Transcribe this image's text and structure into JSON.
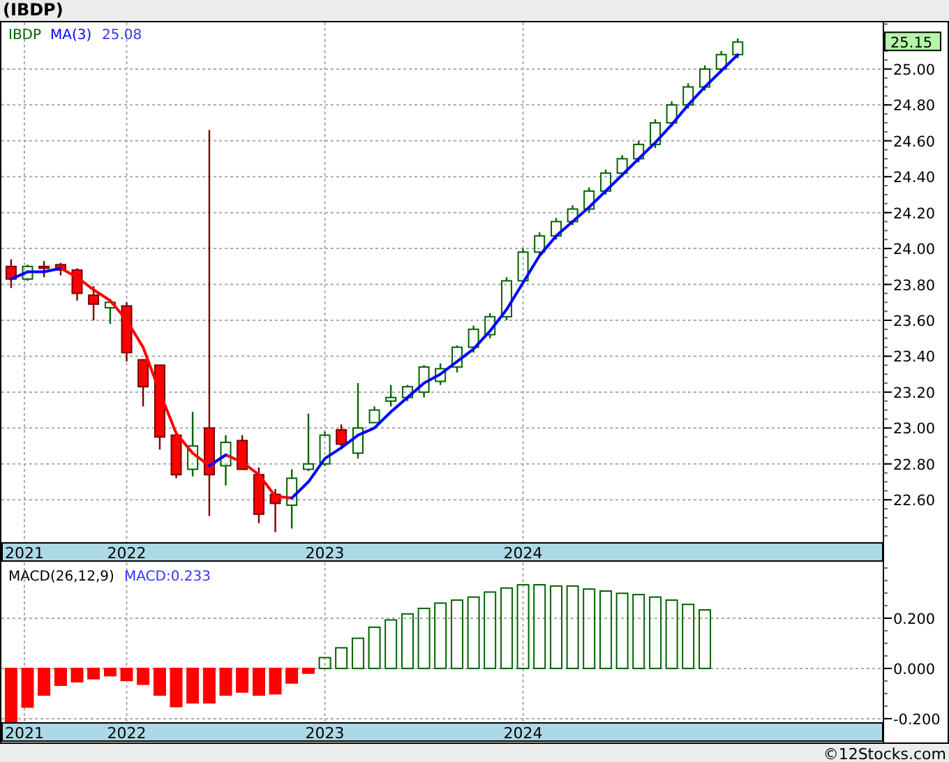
{
  "title": "(IBDP)",
  "price_chart": {
    "legend": {
      "symbol": "IBDP",
      "value": "25.08"
    },
    "last_price": "25.15",
    "chart_data": {
      "type": "candlestick",
      "grid": true,
      "xlim": [
        2021.368,
        2025.818
      ],
      "ylim": [
        22.36,
        25.26
      ],
      "yticks": [
        {
          "value": 22.6,
          "label": "22.60"
        },
        {
          "value": 22.8,
          "label": "22.80"
        },
        {
          "value": 23.0,
          "label": "23.00"
        },
        {
          "value": 23.2,
          "label": "23.20"
        },
        {
          "value": 23.4,
          "label": "23.40"
        },
        {
          "value": 23.6,
          "label": "23.60"
        },
        {
          "value": 23.8,
          "label": "23.80"
        },
        {
          "value": 24.0,
          "label": "24.00"
        },
        {
          "value": 24.2,
          "label": "24.20"
        },
        {
          "value": 24.4,
          "label": "24.40"
        },
        {
          "value": 24.6,
          "label": "24.60"
        },
        {
          "value": 24.8,
          "label": "24.80"
        },
        {
          "value": 25.0,
          "label": "25.00"
        }
      ],
      "xticks": [
        {
          "value": 2021.484,
          "label": "2021"
        },
        {
          "value": 2022,
          "label": "2022"
        },
        {
          "value": 2023,
          "label": "2023"
        },
        {
          "value": 2024,
          "label": "2024"
        }
      ],
      "x": [
        2021.417,
        2021.5,
        2021.583,
        2021.667,
        2021.75,
        2021.833,
        2021.917,
        2022.0,
        2022.083,
        2022.167,
        2022.25,
        2022.333,
        2022.417,
        2022.5,
        2022.583,
        2022.667,
        2022.75,
        2022.833,
        2022.917,
        2023.0,
        2023.083,
        2023.167,
        2023.25,
        2023.333,
        2023.417,
        2023.5,
        2023.583,
        2023.667,
        2023.75,
        2023.833,
        2023.917,
        2024.0,
        2024.083,
        2024.167,
        2024.25,
        2024.333,
        2024.417,
        2024.5,
        2024.583,
        2024.667,
        2024.75,
        2024.833,
        2024.917,
        2025.0,
        2025.083
      ],
      "ohlc": [
        [
          23.9,
          23.94,
          23.78,
          23.83
        ],
        [
          23.83,
          23.91,
          23.82,
          23.9
        ],
        [
          23.9,
          23.93,
          23.84,
          23.89
        ],
        [
          23.91,
          23.92,
          23.85,
          23.88
        ],
        [
          23.88,
          23.89,
          23.71,
          23.75
        ],
        [
          23.74,
          23.79,
          23.6,
          23.69
        ],
        [
          23.67,
          23.71,
          23.58,
          23.7
        ],
        [
          23.68,
          23.7,
          23.37,
          23.42
        ],
        [
          23.38,
          23.38,
          23.12,
          23.23
        ],
        [
          23.35,
          23.35,
          22.88,
          22.95
        ],
        [
          22.96,
          22.96,
          22.72,
          22.74
        ],
        [
          22.77,
          23.09,
          22.73,
          22.9
        ],
        [
          23.0,
          24.66,
          22.51,
          22.74
        ],
        [
          22.79,
          22.96,
          22.68,
          22.92
        ],
        [
          22.93,
          22.96,
          22.77,
          22.77
        ],
        [
          22.74,
          22.78,
          22.47,
          22.52
        ],
        [
          22.63,
          22.66,
          22.42,
          22.58
        ],
        [
          22.57,
          22.77,
          22.44,
          22.72
        ],
        [
          22.77,
          23.08,
          22.76,
          22.8
        ],
        [
          22.8,
          22.98,
          22.79,
          22.96
        ],
        [
          22.99,
          23.02,
          22.88,
          22.91
        ],
        [
          22.86,
          23.25,
          22.83,
          23.0
        ],
        [
          23.03,
          23.12,
          23.03,
          23.1
        ],
        [
          23.15,
          23.24,
          23.12,
          23.17
        ],
        [
          23.17,
          23.24,
          23.15,
          23.23
        ],
        [
          23.2,
          23.35,
          23.17,
          23.34
        ],
        [
          23.26,
          23.36,
          23.24,
          23.33
        ],
        [
          23.34,
          23.46,
          23.31,
          23.45
        ],
        [
          23.45,
          23.57,
          23.42,
          23.55
        ],
        [
          23.52,
          23.64,
          23.5,
          23.62
        ],
        [
          23.62,
          23.84,
          23.6,
          23.82
        ],
        [
          23.82,
          24.0,
          23.8,
          23.98
        ],
        [
          23.98,
          24.09,
          23.96,
          24.07
        ],
        [
          24.07,
          24.17,
          24.05,
          24.15
        ],
        [
          24.15,
          24.24,
          24.13,
          24.22
        ],
        [
          24.22,
          24.34,
          24.2,
          24.32
        ],
        [
          24.32,
          24.44,
          24.3,
          24.42
        ],
        [
          24.42,
          24.52,
          24.4,
          24.5
        ],
        [
          24.5,
          24.6,
          24.48,
          24.58
        ],
        [
          24.58,
          24.72,
          24.56,
          24.7
        ],
        [
          24.7,
          24.82,
          24.68,
          24.8
        ],
        [
          24.8,
          24.92,
          24.78,
          24.9
        ],
        [
          24.9,
          25.02,
          24.88,
          25.0
        ],
        [
          25.0,
          25.1,
          24.98,
          25.08
        ],
        [
          25.08,
          25.17,
          25.06,
          25.15
        ]
      ],
      "series": [
        {
          "name": "MA(3)",
          "type": "line",
          "color": "#0000ff",
          "values": [
            23.83,
            23.87,
            23.87,
            23.89,
            null,
            null,
            null,
            null,
            null,
            null,
            null,
            null,
            22.79,
            22.85,
            null,
            null,
            null,
            22.61,
            22.7,
            22.83,
            22.89,
            22.96,
            23.0,
            23.09,
            23.17,
            23.25,
            23.3,
            23.37,
            23.44,
            23.54,
            23.66,
            23.81,
            23.96,
            24.07,
            24.15,
            24.23,
            24.32,
            24.41,
            24.5,
            24.59,
            24.69,
            24.8,
            24.9,
            24.99,
            25.08
          ]
        },
        {
          "type": "line",
          "color": "#ff0000",
          "values": [
            null,
            null,
            null,
            23.89,
            23.84,
            23.77,
            23.71,
            23.6,
            23.45,
            23.2,
            22.97,
            22.86,
            22.79,
            22.85,
            22.81,
            22.74,
            22.62,
            22.61,
            null,
            null,
            null,
            null,
            null,
            null,
            null,
            null,
            null,
            null,
            null,
            null,
            null,
            null,
            null,
            null,
            null,
            null,
            null,
            null,
            null,
            null,
            null,
            null,
            null,
            null,
            null
          ]
        }
      ]
    }
  },
  "macd_chart": {
    "legend": {
      "label": "MACD(26,12,9)",
      "value": "MACD:0.233"
    },
    "chart_data": {
      "type": "bar",
      "grid": true,
      "xlim": [
        2021.368,
        2025.818
      ],
      "ylim": [
        -0.217,
        0.422
      ],
      "yticks": [
        {
          "value": -0.2,
          "label": "-0.200"
        },
        {
          "value": 0,
          "label": "0.000"
        },
        {
          "value": 0.2,
          "label": "0.200"
        }
      ],
      "xticks": [
        {
          "value": 2021.484,
          "label": "2021"
        },
        {
          "value": 2022,
          "label": "2022"
        },
        {
          "value": 2023,
          "label": "2023"
        },
        {
          "value": 2024,
          "label": "2024"
        }
      ],
      "x": [
        2021.417,
        2021.5,
        2021.583,
        2021.667,
        2021.75,
        2021.833,
        2021.917,
        2022.0,
        2022.083,
        2022.167,
        2022.25,
        2022.333,
        2022.417,
        2022.5,
        2022.583,
        2022.667,
        2022.75,
        2022.833,
        2022.917,
        2023.0,
        2023.083,
        2023.167,
        2023.25,
        2023.333,
        2023.417,
        2023.5,
        2023.583,
        2023.667,
        2023.75,
        2023.833,
        2023.917,
        2024.0,
        2024.083,
        2024.167,
        2024.25,
        2024.333,
        2024.417,
        2024.5,
        2024.583,
        2024.667,
        2024.75,
        2024.833,
        2024.917
      ],
      "series": [
        {
          "color": "#006400",
          "values": [
            null,
            null,
            null,
            null,
            null,
            null,
            null,
            null,
            null,
            null,
            null,
            null,
            null,
            null,
            null,
            null,
            null,
            null,
            null,
            0.043,
            0.082,
            0.12,
            0.164,
            0.193,
            0.217,
            0.239,
            0.26,
            0.272,
            0.284,
            0.304,
            0.32,
            0.333,
            0.333,
            0.328,
            0.328,
            0.316,
            0.308,
            0.299,
            0.294,
            0.284,
            0.272,
            0.255,
            0.233
          ]
        },
        {
          "color": "#ff0000",
          "values": [
            -0.215,
            -0.154,
            -0.106,
            -0.067,
            -0.053,
            -0.041,
            -0.029,
            -0.048,
            -0.063,
            -0.106,
            -0.152,
            -0.137,
            -0.137,
            -0.106,
            -0.094,
            -0.106,
            -0.101,
            -0.058,
            -0.019,
            null,
            null,
            null,
            null,
            null,
            null,
            null,
            null,
            null,
            null,
            null,
            null,
            null,
            null,
            null,
            null,
            null,
            null,
            null,
            null,
            null,
            null,
            null,
            null
          ]
        }
      ]
    }
  },
  "footer": "©12Stocks.com"
}
